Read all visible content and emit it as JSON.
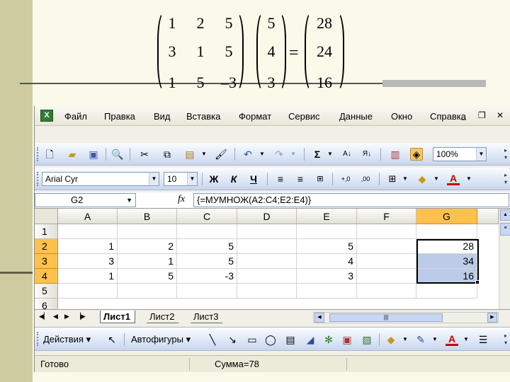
{
  "equation": {
    "matrix_a": [
      [
        "1",
        "2",
        "5"
      ],
      [
        "3",
        "1",
        "5"
      ],
      [
        "1",
        "5",
        "–3"
      ]
    ],
    "vector_b": [
      "5",
      "4",
      "3"
    ],
    "equals": "=",
    "result": [
      "28",
      "24",
      "16"
    ]
  },
  "menu": [
    "Файл",
    "Правка",
    "Вид",
    "Вставка",
    "Формат",
    "Сервис",
    "Данные",
    "Окно",
    "Справка"
  ],
  "window_controls": {
    "min": "_",
    "restore": "❐",
    "close": "✕"
  },
  "toolbar": {
    "zoom": "100%",
    "sigma": "Σ"
  },
  "format_toolbar": {
    "font": "Arial Cyr",
    "size": "10",
    "bold": "Ж",
    "italic": "К",
    "underline": "Ч"
  },
  "formula_bar": {
    "name_box": "G2",
    "fx": "fx",
    "formula": "{=МУМНОЖ(A2:C4;E2:E4)}"
  },
  "sheet": {
    "columns": [
      "A",
      "B",
      "C",
      "D",
      "E",
      "F",
      "G"
    ],
    "rows": [
      "1",
      "2",
      "3",
      "4",
      "5",
      "6"
    ],
    "cells": {
      "r2": {
        "A": "1",
        "B": "2",
        "C": "5",
        "E": "5",
        "G": "28"
      },
      "r3": {
        "A": "3",
        "B": "1",
        "C": "5",
        "E": "4",
        "G": "34"
      },
      "r4": {
        "A": "1",
        "B": "5",
        "C": "-3",
        "E": "3",
        "G": "16"
      }
    },
    "selected_column": "G",
    "selected_rows": [
      "2",
      "3",
      "4"
    ]
  },
  "tabs": [
    "Лист1",
    "Лист2",
    "Лист3"
  ],
  "active_tab": "Лист1",
  "drawbar": {
    "actions": "Действия",
    "autoshapes": "Автофигуры"
  },
  "status": {
    "ready": "Готово",
    "sum": "Сумма=78"
  },
  "colors": {
    "selection_header": "#ffc14e",
    "selection_fill": "#bccbe8",
    "side_strip": "#cdcca0"
  }
}
